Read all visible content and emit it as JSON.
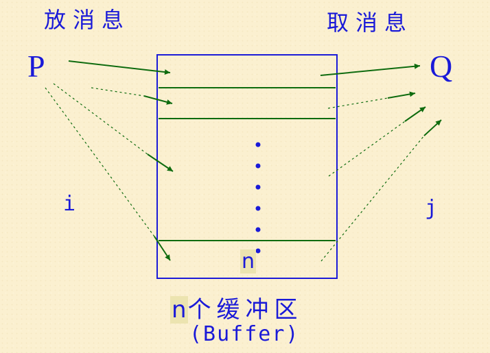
{
  "labels": {
    "put_message": "放消息",
    "take_message": "取消息",
    "producer": "P",
    "consumer": "Q",
    "index_i": "i",
    "index_j": "j",
    "slot_n": "n",
    "caption_n": "n",
    "caption_text": "个缓冲区",
    "caption_sub": "(Buffer)"
  },
  "colors": {
    "text": "#1a1ad8",
    "arrow": "#0e6b0e",
    "buffer_border": "#1a1ad8",
    "slot_line": "#0e6b0e",
    "highlight": "#ece4b0"
  }
}
